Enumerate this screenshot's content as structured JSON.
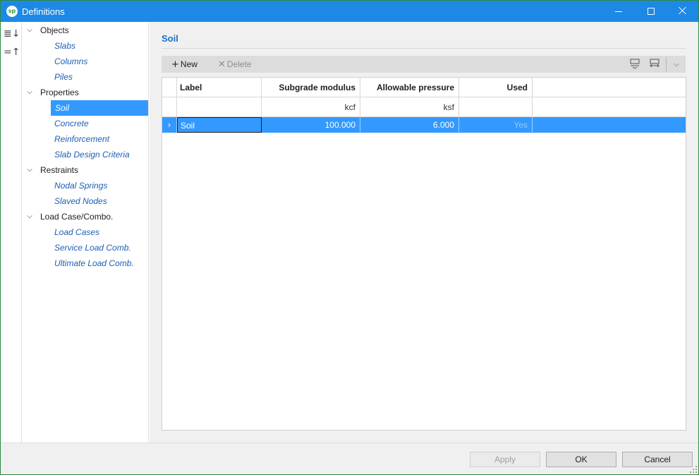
{
  "window": {
    "title": "Definitions",
    "logo_text": "sp",
    "controls": {
      "minimize": "minimize",
      "maximize": "maximize",
      "close": "close"
    }
  },
  "rail": {
    "expand_all_glyph": "≣↓",
    "collapse_all_glyph": "=↑"
  },
  "tree": {
    "groups": [
      {
        "label": "Objects",
        "toggle": "⌵",
        "items": [
          "Slabs",
          "Columns",
          "Piles"
        ]
      },
      {
        "label": "Properties",
        "toggle": "⌵",
        "items": [
          "Soil",
          "Concrete",
          "Reinforcement",
          "Slab Design Criteria"
        ]
      },
      {
        "label": "Restraints",
        "toggle": "⌵",
        "items": [
          "Nodal Springs",
          "Slaved Nodes"
        ]
      },
      {
        "label": "Load Case/Combo.",
        "toggle": "⌵",
        "items": [
          "Load Cases",
          "Service Load Comb.",
          "Ultimate Load Comb."
        ]
      }
    ],
    "selected": "Soil"
  },
  "content": {
    "section_title": "Soil",
    "toolbar": {
      "new_glyph": "+",
      "new_label": "New",
      "delete_glyph": "✕",
      "delete_label": "Delete",
      "insert_above_icon": "insert-row-icon",
      "swap_icon": "swap-rows-icon",
      "more_glyph": "⌵"
    },
    "grid": {
      "headers": [
        "Label",
        "Subgrade modulus",
        "Allowable pressure",
        "Used"
      ],
      "units": [
        "",
        "kcf",
        "ksf",
        ""
      ],
      "rows": [
        {
          "indicator": "›",
          "label": "Soil",
          "subgrade_modulus": "100.000",
          "allowable_pressure": "6.000",
          "used": "Yes"
        }
      ]
    }
  },
  "footer": {
    "apply_label": "Apply",
    "ok_label": "OK",
    "cancel_label": "Cancel"
  }
}
